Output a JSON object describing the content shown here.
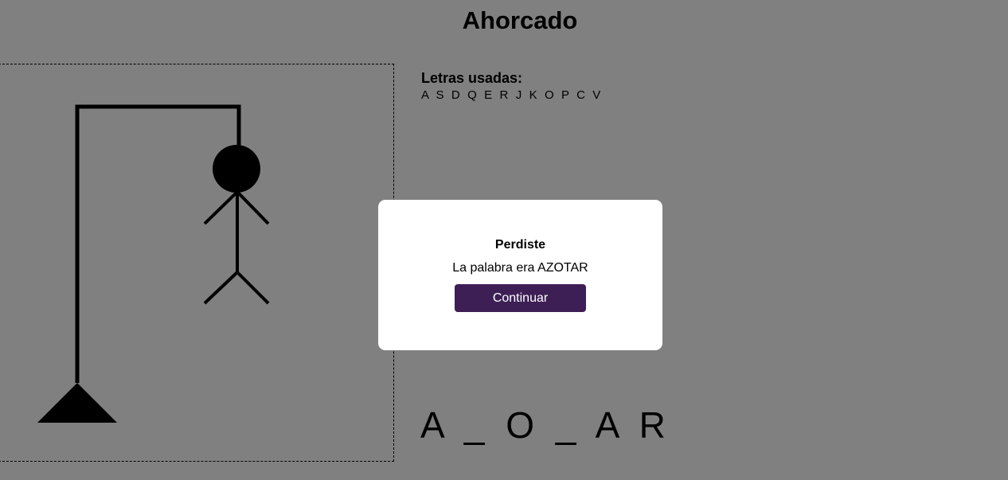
{
  "header": {
    "title": "Ahorcado"
  },
  "used_letters": {
    "heading": "Letras usadas:",
    "letters": "A S D Q E R J K O P C V"
  },
  "word": {
    "display": "A _ O _ A R"
  },
  "modal": {
    "title": "Perdiste",
    "message": "La palabra era AZOTAR",
    "button_label": "Continuar",
    "button_color": "#3d1f56"
  },
  "colors": {
    "background": "#808080",
    "drawing": "#000000",
    "modal_background": "#ffffff"
  }
}
